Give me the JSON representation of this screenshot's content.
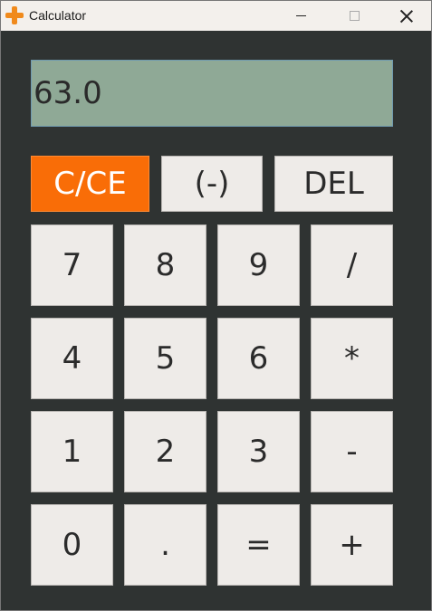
{
  "window": {
    "title": "Calculator",
    "icon": "orange-plus-icon",
    "controls": [
      "minimize",
      "maximize",
      "close"
    ]
  },
  "display": {
    "value": "63.0"
  },
  "top_row": {
    "clear_label": "C/CE",
    "negate_label": "(-)",
    "delete_label": "DEL"
  },
  "keypad": {
    "seven": "7",
    "eight": "8",
    "nine": "9",
    "divide": "/",
    "four": "4",
    "five": "5",
    "six": "6",
    "multiply": "*",
    "one": "1",
    "two": "2",
    "three": "3",
    "subtract": "-",
    "zero": "0",
    "decimal": ".",
    "equals": "=",
    "add": "+"
  },
  "colors": {
    "accent_clear": "#f96d07",
    "display_bg": "#8fa996",
    "window_bg": "#2f3332",
    "key_bg": "#eeebe8"
  }
}
